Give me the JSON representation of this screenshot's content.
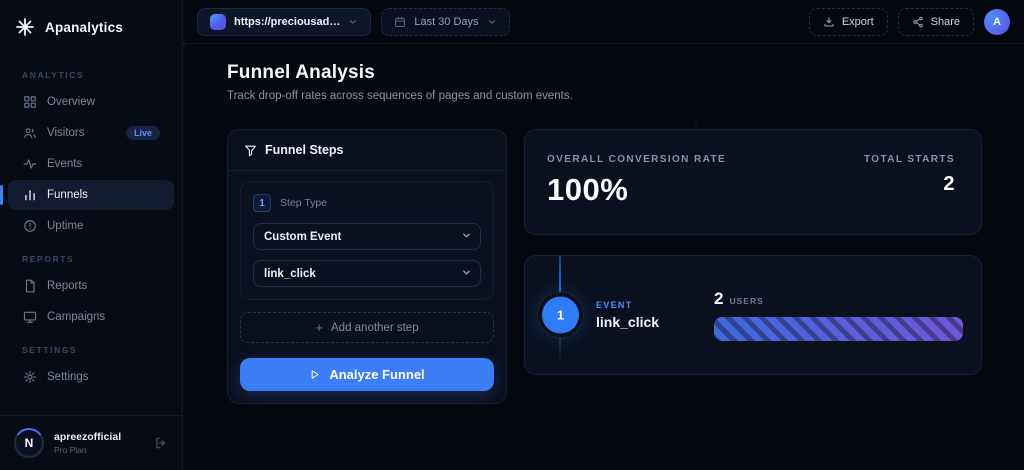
{
  "app": {
    "name": "Apanalytics"
  },
  "topbar": {
    "site_selector": {
      "url": "https://preciousad…"
    },
    "date_range": "Last 30 Days",
    "export_label": "Export",
    "share_label": "Share",
    "avatar_initial": "A"
  },
  "sidebar": {
    "sections": [
      {
        "label": "ANALYTICS",
        "items": [
          {
            "label": "Overview"
          },
          {
            "label": "Visitors",
            "badge": "Live"
          },
          {
            "label": "Events"
          },
          {
            "label": "Funnels",
            "active": true
          },
          {
            "label": "Uptime"
          }
        ]
      },
      {
        "label": "REPORTS",
        "items": [
          {
            "label": "Reports"
          },
          {
            "label": "Campaigns"
          }
        ]
      },
      {
        "label": "SETTINGS",
        "items": [
          {
            "label": "Settings"
          }
        ]
      }
    ],
    "user": {
      "name": "apreezofficial",
      "plan": "Pro Plan",
      "avatar_initial": "N"
    }
  },
  "page": {
    "title": "Funnel Analysis",
    "subtitle": "Track drop-off rates across sequences of pages and custom events."
  },
  "funnel_steps_panel": {
    "title": "Funnel Steps",
    "step": {
      "number": "1",
      "label": "Step Type",
      "type_value": "Custom Event",
      "event_value": "link_click"
    },
    "add_step_plus": "+",
    "add_step_label": "Add another step",
    "analyze_label": "Analyze Funnel"
  },
  "results": {
    "overall_conversion": {
      "label": "OVERALL CONVERSION RATE",
      "value": "100%"
    },
    "total_starts": {
      "label": "TOTAL STARTS",
      "value": "2"
    },
    "steps": [
      {
        "number": "1",
        "type_label": "EVENT",
        "name": "link_click",
        "users": "2",
        "users_label": "USERS",
        "width_pct": 100
      }
    ]
  },
  "colors": {
    "accent_blue": "#3b82f6",
    "bar_gradient_start": "#3e6ada",
    "bar_gradient_end": "#7156d9",
    "background": "#05080f"
  }
}
